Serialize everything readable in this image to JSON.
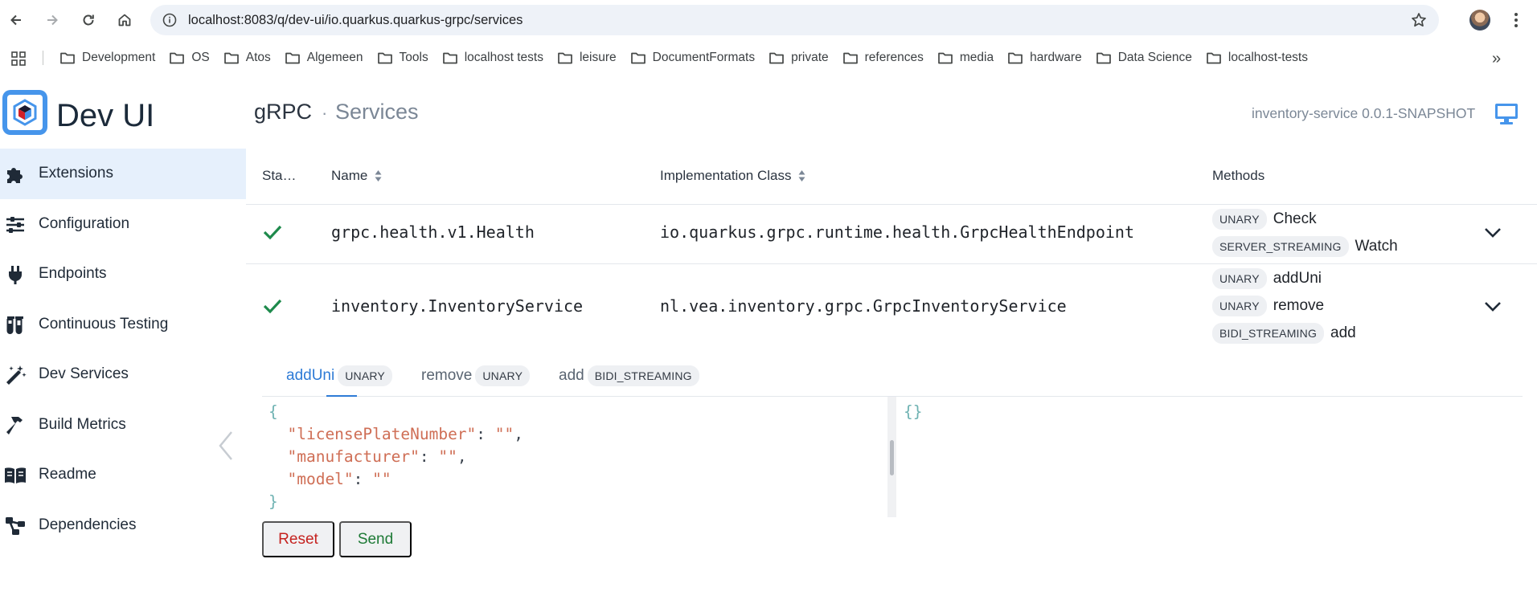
{
  "browser": {
    "url": "localhost:8083/q/dev-ui/io.quarkus.quarkus-grpc/services",
    "bookmarks": [
      "Development",
      "OS",
      "Atos",
      "Algemeen",
      "Tools",
      "localhost tests",
      "leisure",
      "DocumentFormats",
      "private",
      "references",
      "media",
      "hardware",
      "Data Science",
      "localhost-tests"
    ],
    "more_bookmarks": "»"
  },
  "sidebar": {
    "brand": "Dev UI",
    "items": [
      {
        "label": "Extensions",
        "icon": "puzzle-icon"
      },
      {
        "label": "Configuration",
        "icon": "sliders-icon"
      },
      {
        "label": "Endpoints",
        "icon": "plug-icon"
      },
      {
        "label": "Continuous Testing",
        "icon": "flask-icon"
      },
      {
        "label": "Dev Services",
        "icon": "magic-wand-icon"
      },
      {
        "label": "Build Metrics",
        "icon": "hammer-icon"
      },
      {
        "label": "Readme",
        "icon": "book-icon"
      },
      {
        "label": "Dependencies",
        "icon": "tree-icon"
      }
    ],
    "active_index": 0
  },
  "header": {
    "title": "gRPC",
    "separator": "·",
    "subtitle": "Services",
    "app_version": "inventory-service 0.0.1-SNAPSHOT"
  },
  "table": {
    "columns": {
      "status": "Sta…",
      "name": "Name",
      "impl": "Implementation Class",
      "methods": "Methods"
    },
    "rows": [
      {
        "status": "ok",
        "name": "grpc.health.v1.Health",
        "impl": "io.quarkus.grpc.runtime.health.GrpcHealthEndpoint",
        "methods": [
          {
            "type": "UNARY",
            "name": "Check"
          },
          {
            "type": "SERVER_STREAMING",
            "name": "Watch"
          }
        ]
      },
      {
        "status": "ok",
        "name": "inventory.InventoryService",
        "impl": "nl.vea.inventory.grpc.GrpcInventoryService",
        "methods": [
          {
            "type": "UNARY",
            "name": "addUni"
          },
          {
            "type": "UNARY",
            "name": "remove"
          },
          {
            "type": "BIDI_STREAMING",
            "name": "add"
          }
        ]
      }
    ]
  },
  "method_tabs": [
    {
      "name": "addUni",
      "type": "UNARY",
      "active": true
    },
    {
      "name": "remove",
      "type": "UNARY",
      "active": false
    },
    {
      "name": "add",
      "type": "BIDI_STREAMING",
      "active": false
    }
  ],
  "request_editor": {
    "open": "{",
    "fields": [
      {
        "key": "\"licensePlateNumber\"",
        "value": "\"\"",
        "trail": ","
      },
      {
        "key": "\"manufacturer\"",
        "value": "\"\"",
        "trail": ","
      },
      {
        "key": "\"model\"",
        "value": "\"\"",
        "trail": ""
      }
    ],
    "close": "}",
    "colon": ": "
  },
  "response_editor": {
    "content": "{}"
  },
  "buttons": {
    "reset": "Reset",
    "send": "Send"
  },
  "colors": {
    "accent": "#2e7bd6",
    "reset": "#c5221f",
    "send": "#1e7a36",
    "success": "#1e8a4c"
  }
}
